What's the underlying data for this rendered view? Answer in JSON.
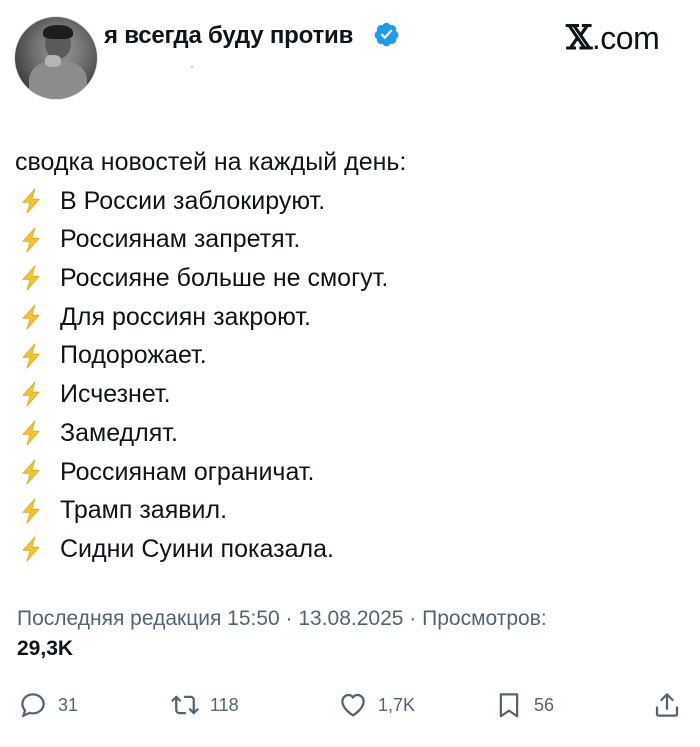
{
  "header": {
    "display_name": "я всегда буду против",
    "handle_fragment": "·",
    "brand_x": "𝕏",
    "brand_suffix": ".com"
  },
  "tweet": {
    "intro": "сводка новостей на каждый день:",
    "bullet_icon": "lightning-bolt-emoji",
    "items": [
      "В России заблокируют.",
      "Россиянам запретят.",
      "Россияне больше не смогут.",
      "Для россиян закроют.",
      "Подорожает.",
      "Исчезнет.",
      "Замедлят.",
      "Россиянам ограничат.",
      "Трамп заявил.",
      "Сидни Суини показала."
    ]
  },
  "meta": {
    "edited_label": "Последняя редакция 15:50 · 13.08.2025 · Просмотров:",
    "views": "29,3K"
  },
  "actions": {
    "replies": "31",
    "reposts": "118",
    "likes": "1,7K",
    "bookmarks": "56"
  },
  "colors": {
    "text": "#0f1419",
    "secondary": "#536471",
    "verified": "#1d9bf0",
    "bolt": "#f4c430"
  }
}
